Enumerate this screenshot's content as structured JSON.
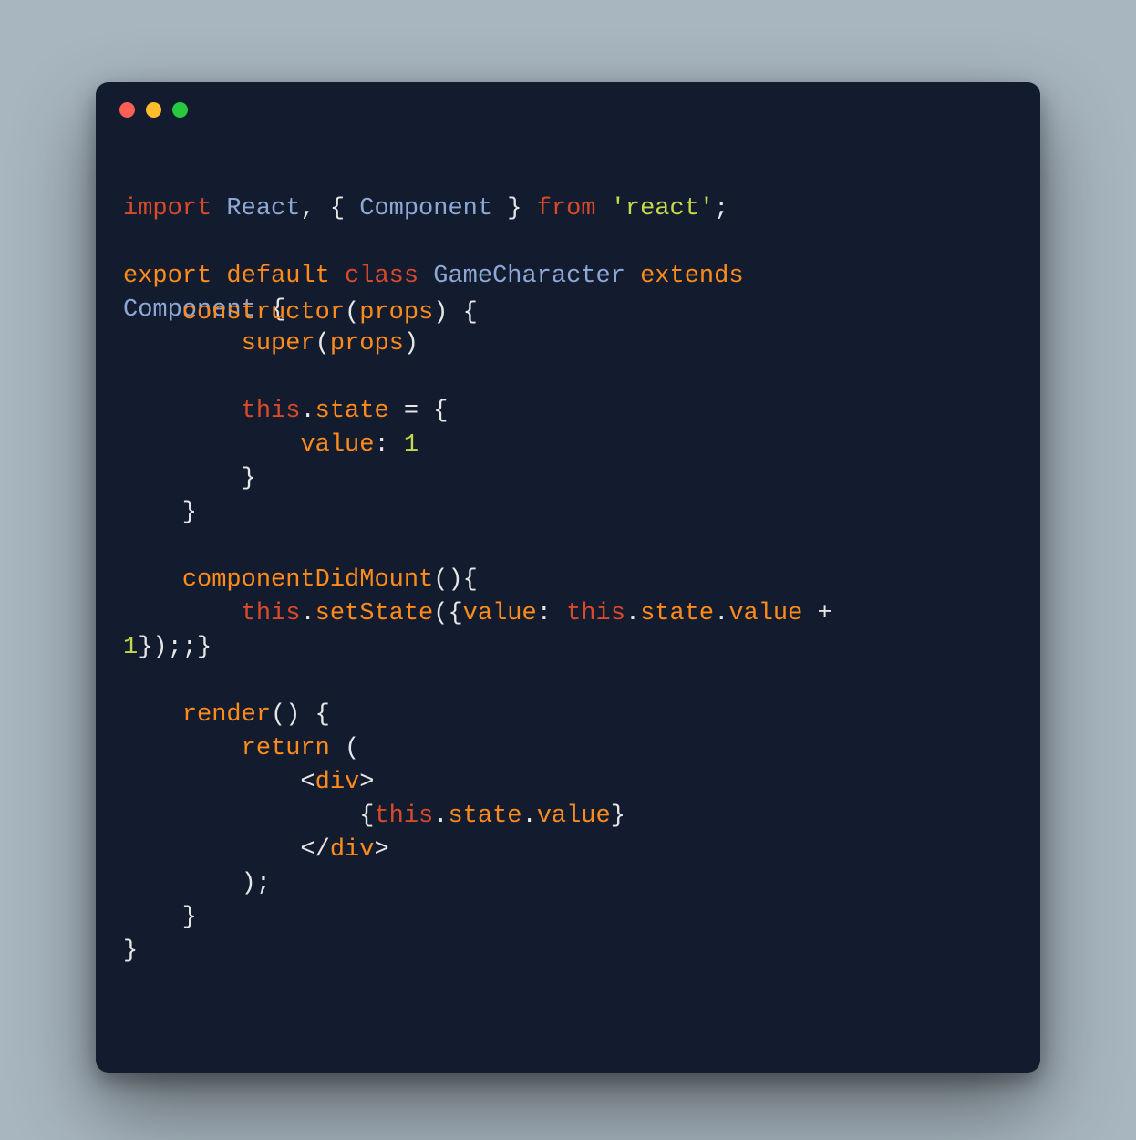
{
  "code": {
    "l1a": "import",
    "l1b": " React",
    "l1c": ", { ",
    "l1d": "Component",
    "l1e": " } ",
    "l1f": "from",
    "l1g": " ",
    "l1h": "'react'",
    "l1i": ";",
    "l3a": "export",
    "l3b": " ",
    "l3c": "default",
    "l3d": " ",
    "l3e": "class",
    "l3f": " ",
    "l3g": "GameCharacter",
    "l3h": " ",
    "l3i": "extends",
    "l3j": " ",
    "l4a": "Component",
    "l4b": " {",
    "ov4a": "    ",
    "ov4b": "constructor",
    "ov4c": "(",
    "ov4d": "props",
    "ov4e": ") {",
    "l5a": "        ",
    "l5b": "super",
    "l5c": "(",
    "l5d": "props",
    "l5e": ")",
    "l7a": "        ",
    "l7b": "this",
    "l7c": ".",
    "l7d": "state",
    "l7e": " = {",
    "l8a": "            ",
    "l8b": "value",
    "l8c": ": ",
    "l8d": "1",
    "l9a": "        }",
    "l10a": "    }",
    "l12a": "    ",
    "l12b": "componentDidMount",
    "l12c": "(){",
    "l13a": "        ",
    "l13b": "this",
    "l13c": ".",
    "l13d": "setState",
    "l13e": "({",
    "l13f": "value",
    "l13g": ": ",
    "l13h": "this",
    "l13i": ".",
    "l13j": "state",
    "l13k": ".",
    "l13l": "value",
    "l13m": " + ",
    "l14a": "1",
    "l14b": "});;}",
    "l16a": "    ",
    "l16b": "render",
    "l16c": "() {",
    "l17a": "        ",
    "l17b": "return",
    "l17c": " (",
    "l18a": "            <",
    "l18b": "div",
    "l18c": ">",
    "l19a": "                {",
    "l19b": "this",
    "l19c": ".",
    "l19d": "state",
    "l19e": ".",
    "l19f": "value",
    "l19g": "}",
    "l20a": "            </",
    "l20b": "div",
    "l20c": ">",
    "l21a": "        );",
    "l22a": "    }",
    "l23a": "}"
  }
}
